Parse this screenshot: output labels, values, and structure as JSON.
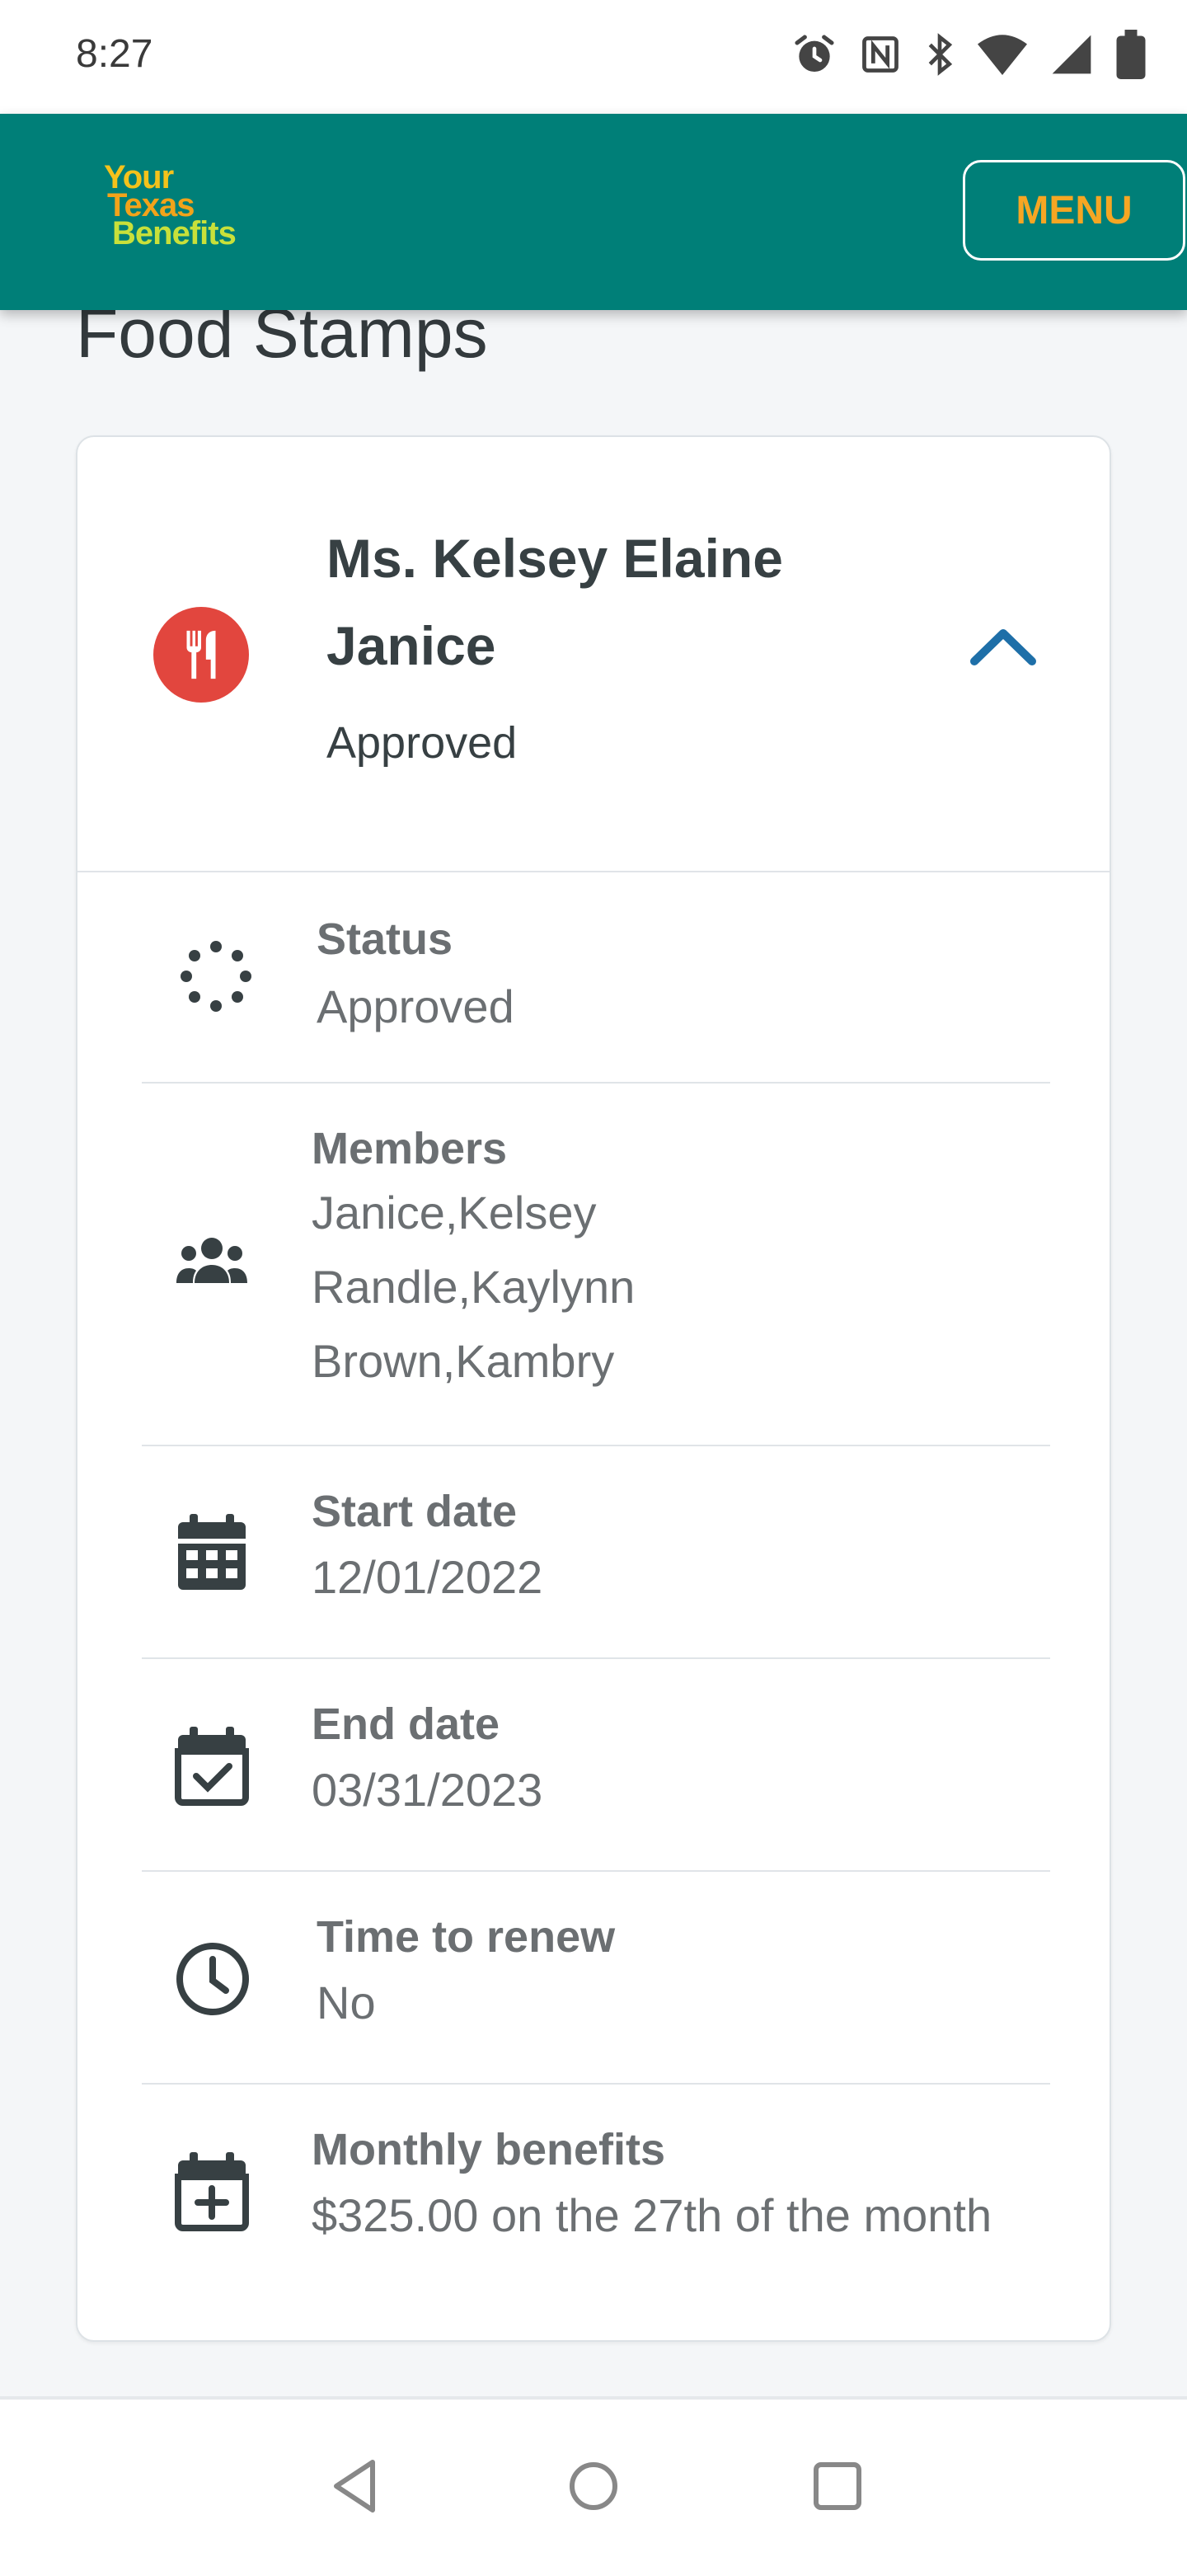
{
  "status_bar": {
    "time": "8:27",
    "icons": [
      "alarm-icon",
      "nfc-icon",
      "bluetooth-icon",
      "wifi-icon",
      "signal-icon",
      "battery-icon"
    ]
  },
  "app_bar": {
    "logo": [
      "Your",
      "Texas",
      "Benefits"
    ],
    "menu_label": "MENU",
    "color": "#007f78",
    "menu_color": "#f6a623"
  },
  "page_title": "Food Stamps",
  "card": {
    "icon": "fork-knife-icon",
    "name": "Ms. Kelsey Elaine Janice",
    "status": "Approved",
    "expanded": true,
    "details": [
      {
        "icon": "spinner-dots-icon",
        "label": "Status",
        "value": "Approved"
      },
      {
        "icon": "people-group-icon",
        "label": "Members",
        "value_lines": [
          "Janice,Kelsey",
          "Randle,Kaylynn",
          "Brown,Kambry"
        ]
      },
      {
        "icon": "calendar-grid-icon",
        "label": "Start date",
        "value": "12/01/2022"
      },
      {
        "icon": "calendar-check-icon",
        "label": "End date",
        "value": "03/31/2023"
      },
      {
        "icon": "clock-icon",
        "label": "Time to renew",
        "value": "No"
      },
      {
        "icon": "calendar-plus-icon",
        "label": "Monthly benefits",
        "value": "$325.00 on the 27th of the month"
      }
    ]
  },
  "nav_bar": {
    "buttons": [
      "back-icon",
      "home-icon",
      "recents-icon"
    ]
  }
}
